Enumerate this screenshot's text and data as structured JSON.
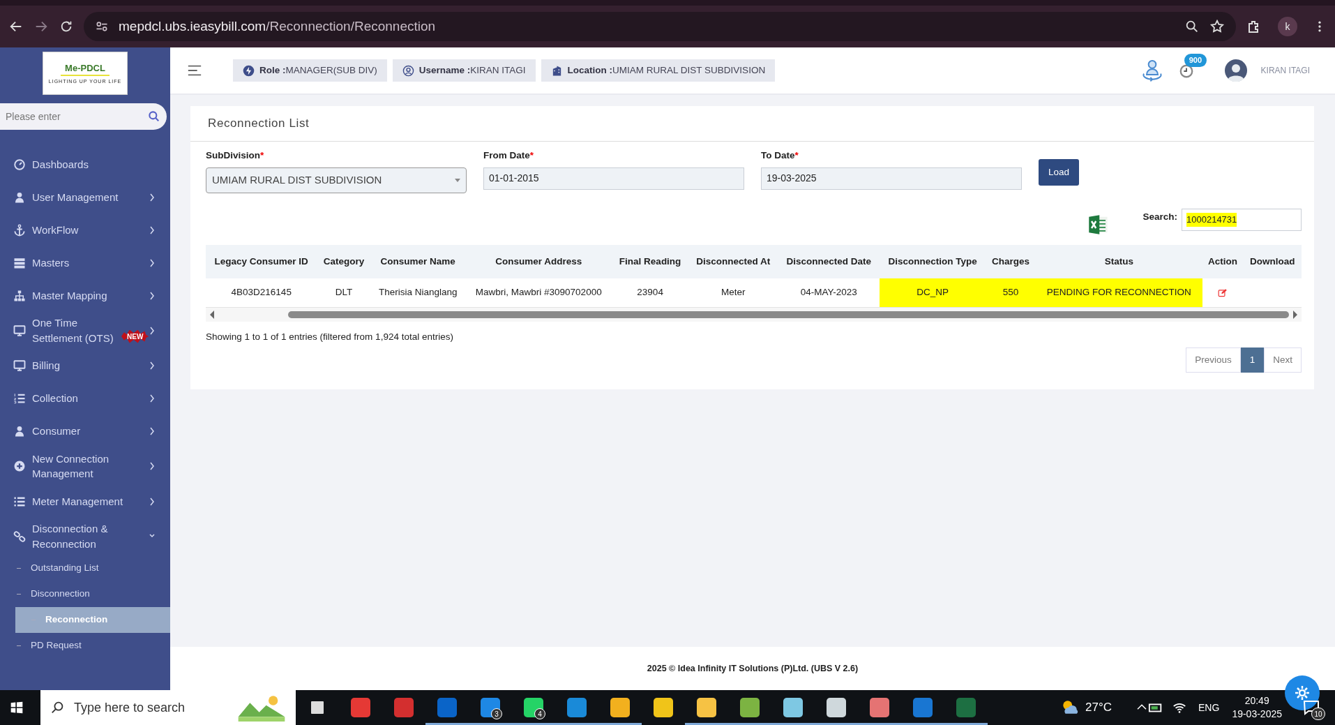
{
  "browser": {
    "url_host": "mepdcl.ubs.ieasybill.com",
    "url_path": "/Reconnection/Reconnection",
    "profile": "k"
  },
  "sidebar": {
    "logo": {
      "title": "Me-PDCL",
      "tagline": "LIGHTING UP YOUR LIFE"
    },
    "search": {
      "placeholder": "Please enter"
    },
    "items": [
      {
        "label": "Dashboards",
        "submenu": false
      },
      {
        "label": "User Management",
        "submenu": true,
        "expanded": false
      },
      {
        "label": "WorkFlow",
        "submenu": true,
        "expanded": false
      },
      {
        "label": "Masters",
        "submenu": true,
        "expanded": false
      },
      {
        "label": "Master Mapping",
        "submenu": true,
        "expanded": false
      },
      {
        "label": "One Time Settlement (OTS)",
        "badge": "NEW",
        "submenu": true,
        "expanded": false
      },
      {
        "label": "Billing",
        "submenu": true,
        "expanded": false
      },
      {
        "label": "Collection",
        "submenu": true,
        "expanded": false
      },
      {
        "label": "Consumer",
        "submenu": true,
        "expanded": false
      },
      {
        "label": "New Connection Management",
        "submenu": true,
        "expanded": false
      },
      {
        "label": "Meter Management",
        "submenu": true,
        "expanded": false
      },
      {
        "label": "Disconnection & Reconnection",
        "submenu": true,
        "expanded": true,
        "children": [
          {
            "label": "Outstanding List",
            "selected": false
          },
          {
            "label": "Disconnection",
            "selected": false
          },
          {
            "label": "Reconnection",
            "selected": true
          },
          {
            "label": "PD Request",
            "selected": false
          }
        ]
      }
    ]
  },
  "header": {
    "chips": [
      {
        "label": "Role :",
        "value": "MANAGER(SUB DIV)"
      },
      {
        "label": "Username :",
        "value": "KIRAN ITAGI"
      },
      {
        "label": "Location :",
        "value": "UMIAM RURAL DIST SUBDIVISION"
      }
    ],
    "notification_count": "900",
    "user": "KIRAN ITAGI"
  },
  "page": {
    "title": "Reconnection List",
    "fields": [
      {
        "kind": "select",
        "label": "SubDivision",
        "required_mark": "*",
        "value": "UMIAM RURAL DIST SUBDIVISION"
      },
      {
        "kind": "text",
        "label": "From Date",
        "required_mark": "*",
        "value": "01-01-2015"
      },
      {
        "kind": "text",
        "label": "To Date",
        "required_mark": "*",
        "value": "19-03-2025"
      }
    ],
    "load_button": "Load",
    "search": {
      "label": "Search:",
      "value": "1000214731",
      "highlighted": true
    },
    "table": {
      "columns": [
        "Legacy Consumer ID",
        "Category",
        "Consumer Name",
        "Consumer Address",
        "Final Reading",
        "Disconnected At",
        "Disconnected Date",
        "Disconnection Type",
        "Charges",
        "Status",
        "Action",
        "Download"
      ],
      "rows": [
        {
          "cells": [
            {
              "text": "4B03D216145",
              "highlighted": false
            },
            {
              "text": "DLT",
              "highlighted": false
            },
            {
              "text": "Therisia Nianglang",
              "highlighted": false
            },
            {
              "text": "Mawbri, Mawbri #3090702000",
              "highlighted": false
            },
            {
              "text": "23904",
              "highlighted": false
            },
            {
              "text": "Meter",
              "highlighted": false
            },
            {
              "text": "04-MAY-2023",
              "highlighted": false
            },
            {
              "text": "DC_NP",
              "highlighted": true
            },
            {
              "text": "550",
              "highlighted": true
            },
            {
              "text": "PENDING FOR RECONNECTION",
              "highlighted": true
            }
          ]
        }
      ]
    },
    "info": "Showing 1 to 1 of 1 entries (filtered from 1,924 total entries)",
    "pagination": [
      {
        "label": "Previous",
        "selected": false
      },
      {
        "label": "1",
        "selected": true
      },
      {
        "label": "Next",
        "selected": false
      }
    ]
  },
  "footer": {
    "text": "2025 © Idea Infinity IT Solutions (P)Ltd. (UBS V 2.6)"
  },
  "taskbar": {
    "search_placeholder": "Type here to search",
    "apps": [
      {
        "running": false
      },
      {
        "running": false
      },
      {
        "running": false
      },
      {
        "running": true
      },
      {
        "badge": "3",
        "running": true
      },
      {
        "badge": "4",
        "running": true
      },
      {
        "running": true
      },
      {
        "running": true
      },
      {
        "running": false
      },
      {
        "running": true
      },
      {
        "running": true
      },
      {
        "running": true
      },
      {
        "running": true
      },
      {
        "running": true
      },
      {
        "running": true
      },
      {
        "running": true
      }
    ],
    "temperature": "27°C",
    "language": "ENG",
    "time": "20:49",
    "date": "19-03-2025",
    "notifications": "10"
  }
}
